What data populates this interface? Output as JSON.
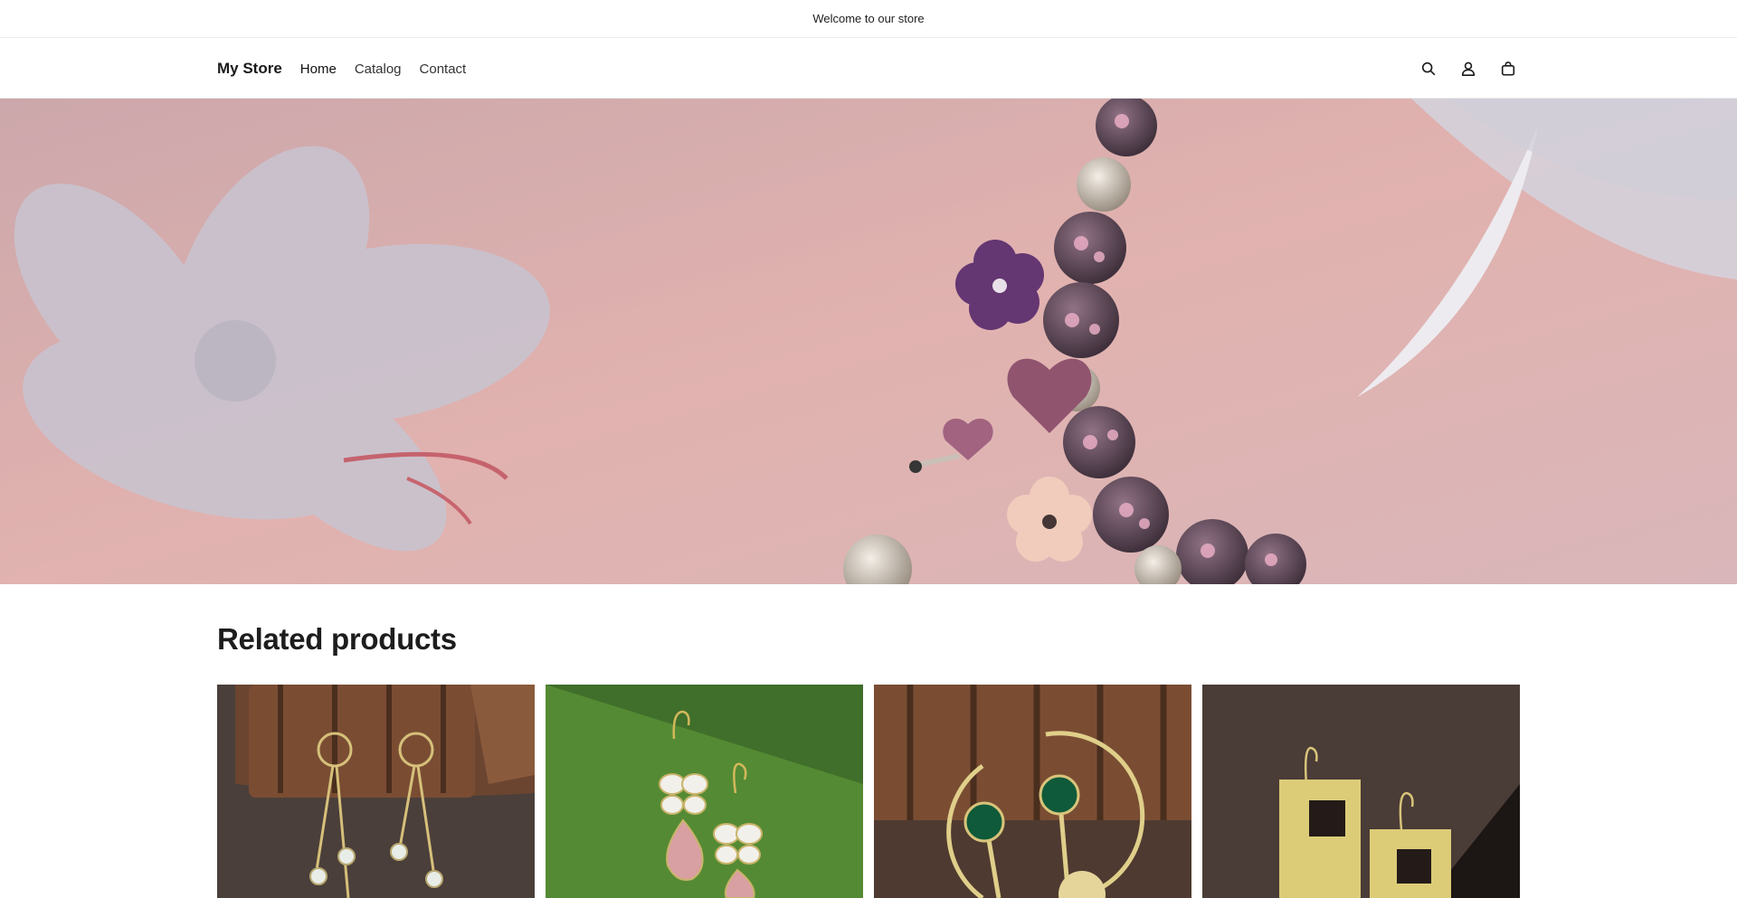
{
  "announcement": {
    "text": "Welcome to our store"
  },
  "header": {
    "logo": "My Store",
    "nav": [
      {
        "label": "Home"
      },
      {
        "label": "Catalog"
      },
      {
        "label": "Contact"
      }
    ],
    "icons": [
      "search-icon",
      "account-icon",
      "cart-icon"
    ]
  },
  "hero": {
    "image": "pink-charm-bracelet-with-flowers",
    "colors": {
      "background": "#d8a9a8",
      "petal": "#c3b9c6",
      "bead": "#3a2a36"
    }
  },
  "related": {
    "title": "Related products",
    "products": [
      {
        "image": "gold-drop-earrings-pearls",
        "background": "#4a3f3a"
      },
      {
        "image": "butterfly-pink-stone-earrings",
        "background": "#4b7a2e"
      },
      {
        "image": "green-stone-half-moon-earrings",
        "background": "#5a4538"
      },
      {
        "image": "gold-square-cutout-earrings",
        "background": "#2d2422"
      }
    ]
  }
}
